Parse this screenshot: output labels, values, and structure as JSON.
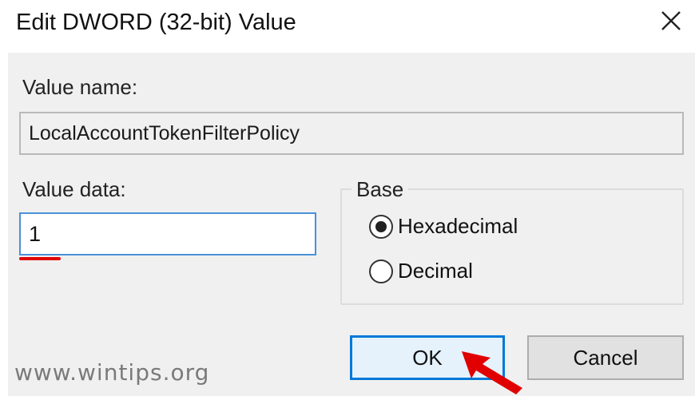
{
  "dialog": {
    "title": "Edit DWORD (32-bit) Value",
    "close_icon": "close-icon"
  },
  "fields": {
    "value_name_label": "Value name:",
    "value_name": "LocalAccountTokenFilterPolicy",
    "value_data_label": "Value data:",
    "value_data": "1"
  },
  "base": {
    "legend": "Base",
    "options": [
      {
        "label": "Hexadecimal",
        "selected": true
      },
      {
        "label": "Decimal",
        "selected": false
      }
    ]
  },
  "buttons": {
    "ok_label": "OK",
    "cancel_label": "Cancel"
  },
  "watermark": "www.wintips.org",
  "colors": {
    "focus_border": "#0078d7",
    "annotation_red": "#e00000"
  }
}
